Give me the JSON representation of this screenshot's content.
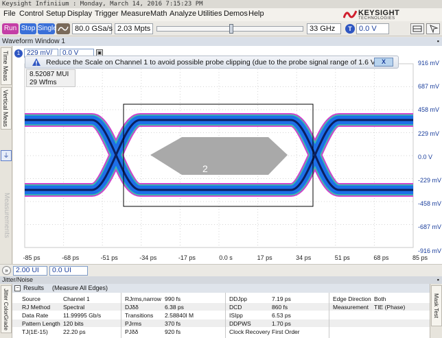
{
  "window": {
    "title": "Keysight Infiniium : Monday, March 14, 2016 7:15:23 PM"
  },
  "menu": [
    "File",
    "Control",
    "Setup",
    "Display",
    "Trigger",
    "Measure",
    "Math",
    "Analyze",
    "Utilities",
    "Demos",
    "Help"
  ],
  "brand": {
    "name": "KEYSIGHT",
    "sub": "TECHNOLOGIES"
  },
  "toolbar": {
    "run_label": "Run",
    "stop_label": "Stop",
    "single_label": "Single",
    "sample_rate": "80.0 GSa/s",
    "memory_depth": "2.03 Mpts",
    "bandwidth": "33 GHz",
    "trigger_label": "T",
    "trigger_level": "0.0 V"
  },
  "waveform_window": {
    "title": "Waveform Window 1",
    "channel_number": "1",
    "channel_scale": "229 mV/",
    "channel_offset": "0.0 V",
    "side_tabs": [
      "Time Meas",
      "Vertical Meas",
      "Measurements"
    ],
    "warning": "Reduce the Scale on Channel 1 to avoid possible probe clipping (due to the probe signal range of 1.6 V).",
    "warning_close": "X",
    "readout_line1": "8.52087 MUI",
    "readout_line2": "29 Wfms",
    "mask_label": "2",
    "marker_label": "1",
    "y_labels": [
      "916 mV",
      "687 mV",
      "458 mV",
      "229 mV",
      "0.0 V",
      "-229 mV",
      "-458 mV",
      "-687 mV",
      "-916 mV"
    ],
    "x_labels": [
      "-85 ps",
      "-68 ps",
      "-51 ps",
      "-34 ps",
      "-17 ps",
      "0.0 s",
      "17 ps",
      "34 ps",
      "51 ps",
      "68 ps",
      "85 ps"
    ]
  },
  "horizontal": {
    "scale": "2.00 UI",
    "position": "0.0 UI"
  },
  "jitter": {
    "panel_title": "Jitter/Noise",
    "side_tab_left": "Jitter ColorGrade",
    "side_tab_right": "Mask Test",
    "results_label": "Results",
    "results_scope": "(Measure All Edges)",
    "col1": [
      {
        "k": "Source",
        "v": "Channel 1"
      },
      {
        "k": "RJ Method",
        "v": "Spectral"
      },
      {
        "k": "Data Rate",
        "v": "11.99995 Gb/s"
      },
      {
        "k": "Pattern Length",
        "v": "120 bits"
      },
      {
        "k": "TJ(1E-15)",
        "v": "22.20 ps"
      }
    ],
    "col2": [
      {
        "k": "RJrms,narrow",
        "v": "990 fs"
      },
      {
        "k": "DJδδ",
        "v": "6.38 ps"
      },
      {
        "k": "Transitions",
        "v": "2.58840l M"
      },
      {
        "k": "PJrms",
        "v": "370 fs"
      },
      {
        "k": "PJδδ",
        "v": "920 fs"
      }
    ],
    "col3": [
      {
        "k": "DDJpp",
        "v": "7.19 ps"
      },
      {
        "k": "DCD",
        "v": "860 fs"
      },
      {
        "k": "ISIpp",
        "v": "6.53 ps"
      },
      {
        "k": "DDPWS",
        "v": "1.70 ps"
      },
      {
        "k": "Clock Recovery",
        "v": "First Order"
      }
    ],
    "col4": [
      {
        "k": "Edge Direction",
        "v": "Both"
      },
      {
        "k": "Measurement",
        "v": "TIE (Phase)"
      }
    ]
  },
  "colors": {
    "eye_outer": "#cc44cc",
    "eye_mid": "#1e6fe8",
    "eye_core": "#0a2060",
    "run": "#c43ea6",
    "stop": "#3a6fd8",
    "single": "#3a6fd8"
  }
}
